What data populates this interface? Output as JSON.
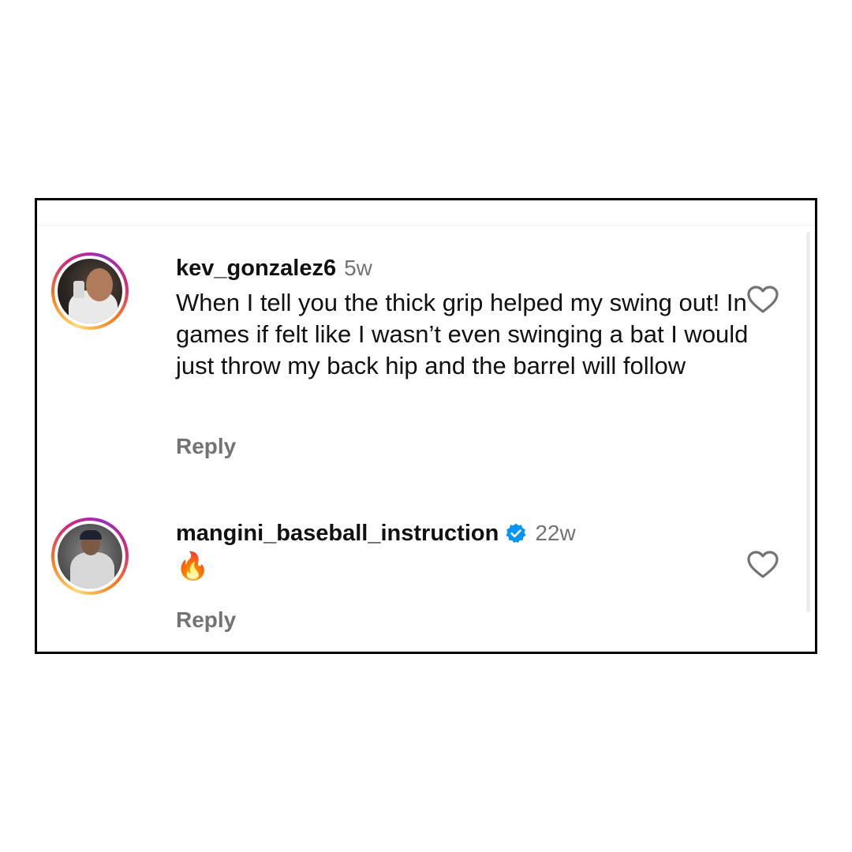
{
  "comments": [
    {
      "username": "kev_gonzalez6",
      "time": "5w",
      "text": "When I tell you the thick grip helped my swing out! In games if felt like I wasn’t even swinging a bat I would just throw my back hip and the barrel will follow",
      "reply_label": "Reply",
      "verified": false,
      "avatar_icon": "person-drinking-avatar",
      "like_icon": "heart-outline-icon"
    },
    {
      "username": "mangini_baseball_instruction",
      "time": "22w",
      "text": "🔥",
      "reply_label": "Reply",
      "verified": true,
      "avatar_icon": "baseball-player-avatar",
      "like_icon": "heart-outline-icon"
    }
  ],
  "colors": {
    "verified_badge": "#0095f6",
    "secondary_text": "#737373",
    "story_ring": [
      "#feda75",
      "#fa7e1e",
      "#d62976",
      "#962fbf"
    ]
  }
}
